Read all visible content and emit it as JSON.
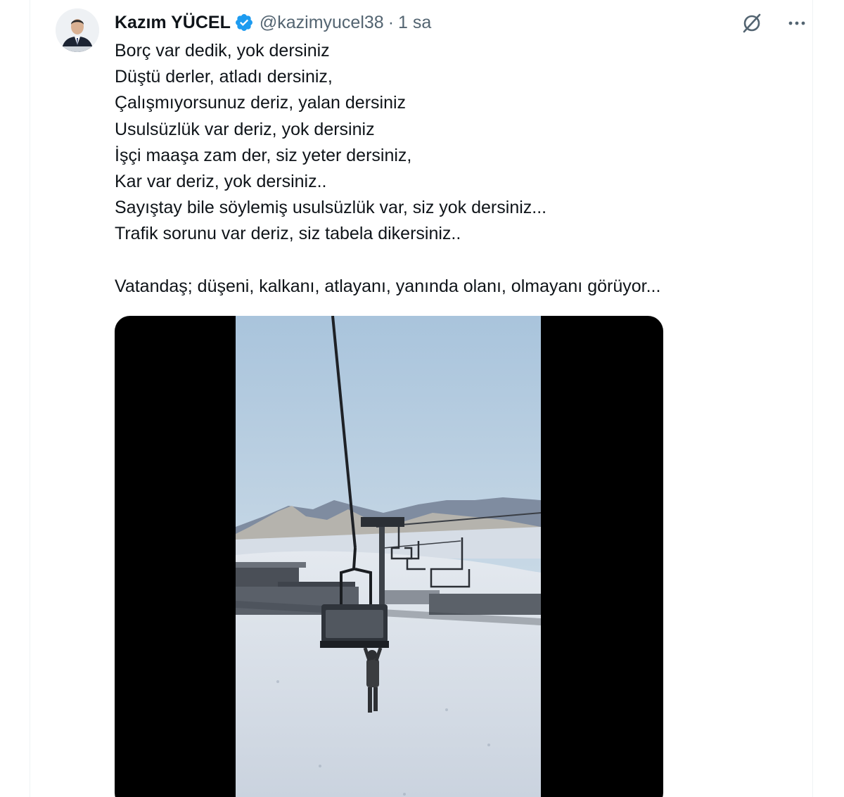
{
  "tweet": {
    "author": {
      "display_name": "Kazım YÜCEL",
      "handle": "@kazimyucel38",
      "verified": true
    },
    "separator": "·",
    "timestamp": "1 sa",
    "lines": [
      "Borç var dedik, yok dersiniz",
      "Düştü derler, atladı dersiniz,",
      "Çalışmıyorsunuz deriz, yalan dersiniz",
      "Usulsüzlük var deriz, yok dersiniz",
      "İşçi maaşa zam der, siz yeter dersiniz,",
      "Kar var deriz, yok dersiniz..",
      "Sayıştay bile söylemiş usulsüzlük var, siz yok dersiniz...",
      "Trafik sorunu var deriz, siz tabela dikersiniz.."
    ],
    "closing_line": "Vatandaş; düşeni, kalkanı, atlayanı, yanında olanı, olmayanı görüyor...",
    "media": {
      "type": "video"
    }
  },
  "icons": {
    "verified": "verified-badge-icon",
    "grok": "grok-icon",
    "more": "more-icon"
  },
  "colors": {
    "text_primary": "#0f1419",
    "text_secondary": "#536471",
    "verified_blue": "#1d9bf0",
    "media_background": "#000000"
  }
}
